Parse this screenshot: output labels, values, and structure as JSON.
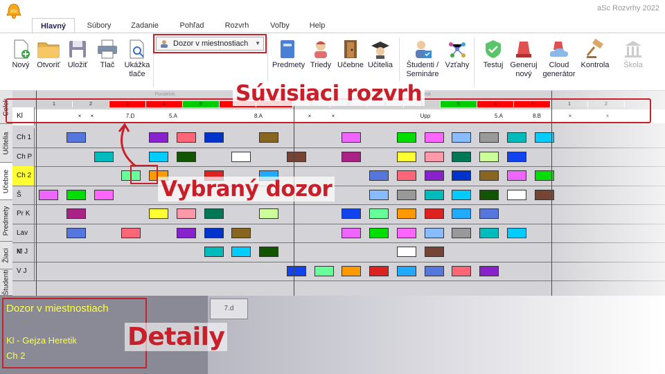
{
  "app": {
    "title": "aSc Rozvrhy 2022",
    "logo_text": "aSc"
  },
  "tabs": [
    {
      "label": "Hlavný",
      "active": true
    },
    {
      "label": "Súbory",
      "active": false
    },
    {
      "label": "Zadanie",
      "active": false
    },
    {
      "label": "Pohľad",
      "active": false
    },
    {
      "label": "Rozvrh",
      "active": false
    },
    {
      "label": "Voľby",
      "active": false
    },
    {
      "label": "Help",
      "active": false
    }
  ],
  "ribbon": {
    "file_buttons": [
      {
        "label": "Nový",
        "icon": "new-document-icon"
      },
      {
        "label": "Otvoriť",
        "icon": "folder-icon",
        "dropdown": true
      },
      {
        "label": "Uložiť",
        "icon": "floppy-icon",
        "dropdown": true
      },
      {
        "label": "Tlač",
        "icon": "printer-icon",
        "dropdown": true
      },
      {
        "label": "Ukážka tlače",
        "icon": "print-preview-icon"
      }
    ],
    "view_select": {
      "value": "Dozor v miestnostiach"
    },
    "data_buttons": [
      {
        "label": "Predmety",
        "icon": "book-icon"
      },
      {
        "label": "Triedy",
        "icon": "class-icon"
      },
      {
        "label": "Učebne",
        "icon": "door-icon"
      },
      {
        "label": "Učitelia",
        "icon": "teacher-icon"
      },
      {
        "label": "Študenti / Semináre",
        "icon": "students-icon"
      },
      {
        "label": "Vzťahy",
        "icon": "relations-icon"
      },
      {
        "label": "Testuj",
        "icon": "check-icon"
      },
      {
        "label": "Generuj nový",
        "icon": "generate-icon"
      },
      {
        "label": "Cloud generátor",
        "icon": "cloud-generator-icon"
      },
      {
        "label": "Kontrola",
        "icon": "gavel-icon"
      },
      {
        "label": "Škola",
        "icon": "school-icon",
        "disabled": true
      }
    ]
  },
  "side_tabs": [
    "Celok",
    "Učitelia",
    "Učebne",
    "Predmety",
    "Žiaci",
    "Študenti"
  ],
  "header": {
    "days": [
      "Pondelok",
      "Utorok"
    ],
    "periods_day1": [
      "1",
      "2",
      "3",
      "4",
      "5",
      "6",
      "7"
    ],
    "periods_day2": [
      "1",
      "2",
      "3",
      "4",
      "5",
      "6",
      "7"
    ],
    "periods_day3": [
      "1",
      "2"
    ],
    "period_colors_day1": [
      "#d0d0d0",
      "#d0d0d0",
      "#ff0000",
      "#ff0000",
      "#00cc00",
      "#ff0000",
      "#ff0000"
    ],
    "period_colors_day2": [
      "#d0d0d0",
      "#d0d0d0",
      "#d0d0d0",
      "#d0d0d0",
      "#00cc00",
      "#ff0000",
      "#ff0000"
    ]
  },
  "kl_row": {
    "label": "Kl",
    "cells": [
      "×",
      "×",
      "7.D",
      "5.A",
      "8.A",
      "×",
      "×",
      "Upp",
      "5.A",
      "8.B",
      "×",
      "×"
    ]
  },
  "rows": [
    {
      "label": "Ch 1",
      "selected": false
    },
    {
      "label": "Ch P",
      "selected": false
    },
    {
      "label": "Ch 2",
      "selected": true
    },
    {
      "label": "Š",
      "selected": false
    },
    {
      "label": "Pr K",
      "selected": false
    },
    {
      "label": "Lav K",
      "selected": false
    },
    {
      "label": "M J",
      "selected": false
    },
    {
      "label": "V J",
      "selected": false
    }
  ],
  "callouts": {
    "related": "Súvisiaci rozvrh",
    "selected": "Vybraný dozor",
    "details": "Detaily"
  },
  "details": {
    "title": "Dozor v miestnostiach",
    "teacher": "Kl - Gejza Heretik",
    "room": "Ch 2",
    "card_label": "7.d"
  }
}
